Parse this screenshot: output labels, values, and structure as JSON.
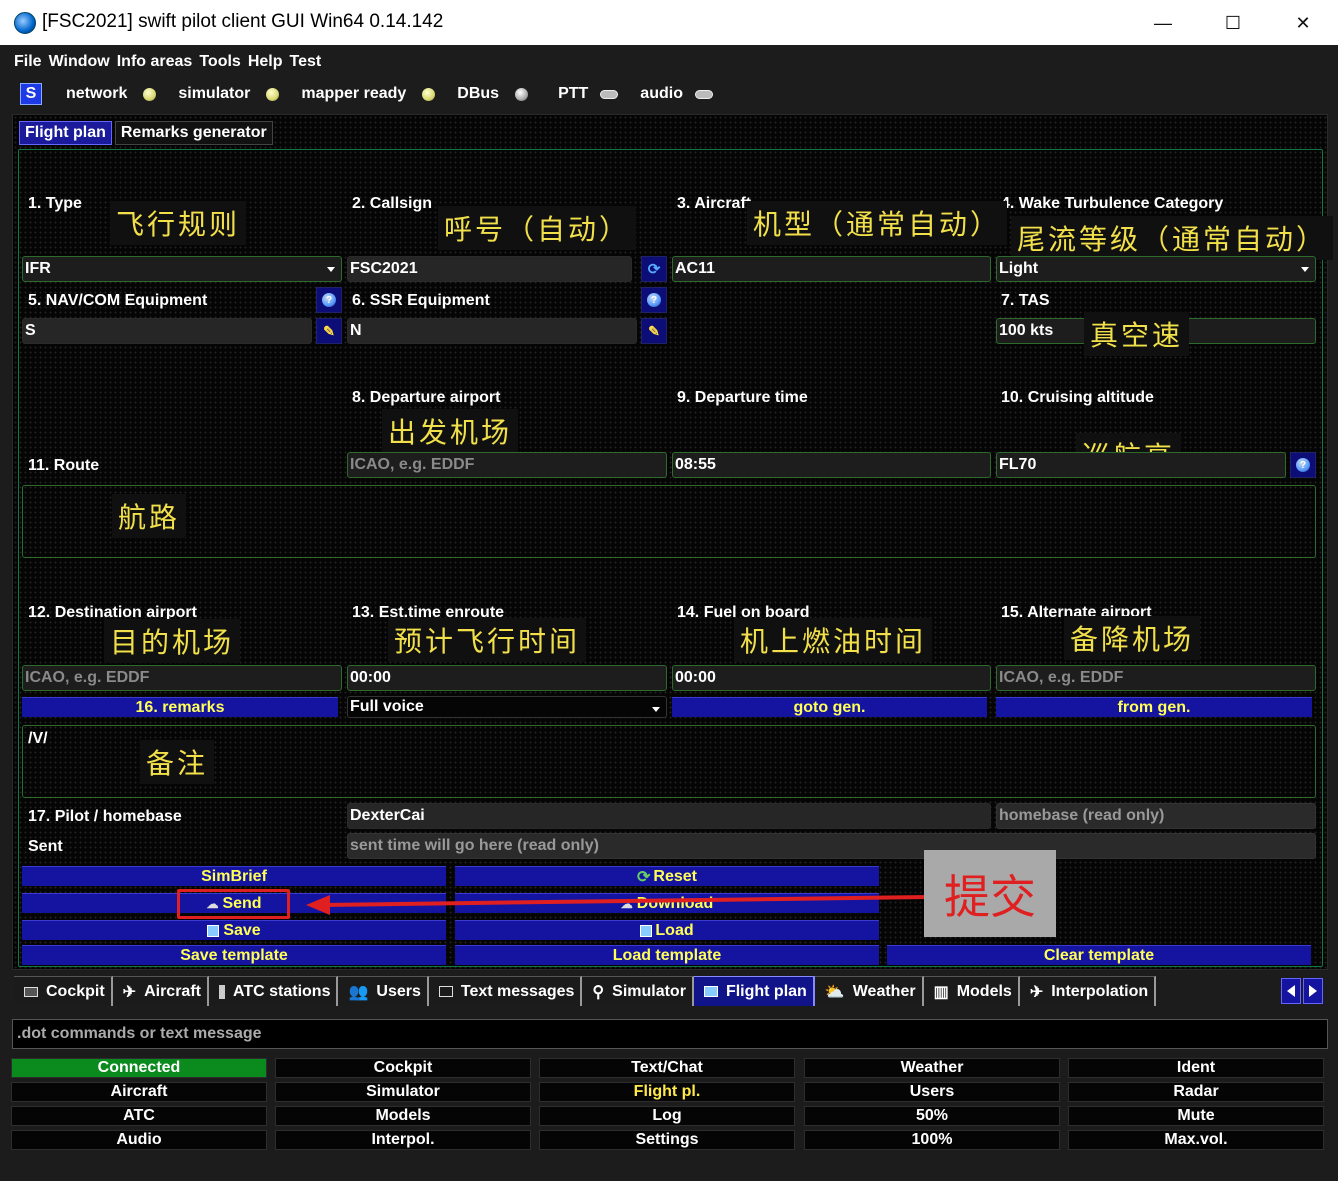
{
  "window": {
    "title": "[FSC2021] swift pilot client GUI Win64 0.14.142",
    "minimize": "—",
    "maximize": "☐",
    "close": "✕"
  },
  "menu": [
    "File",
    "Window",
    "Info areas",
    "Tools",
    "Help",
    "Test"
  ],
  "status": {
    "badge": "S",
    "items": [
      "network",
      "simulator",
      "mapper ready",
      "DBus",
      "PTT",
      "audio"
    ]
  },
  "tabs": {
    "flight_plan": "Flight plan",
    "remarks_generator": "Remarks generator"
  },
  "form": {
    "type": {
      "label": "1. Type",
      "value": "IFR",
      "note": "飞行规则"
    },
    "callsign": {
      "label": "2. Callsign",
      "value": "FSC2021",
      "note": "呼号（自动）"
    },
    "aircraft": {
      "label": "3. Aircraft",
      "value": "AC11",
      "note": "机型（通常自动）"
    },
    "wake": {
      "label": "4. Wake Turbulence Category",
      "value": "Light",
      "note": "尾流等级（通常自动）"
    },
    "navcom": {
      "label": "5. NAV/COM Equipment",
      "value": "S"
    },
    "ssr": {
      "label": "6. SSR Equipment",
      "value": "N"
    },
    "tas": {
      "label": "7. TAS",
      "value": "100 kts",
      "note": "真空速"
    },
    "departure": {
      "label": "8. Departure airport",
      "placeholder": "ICAO, e.g. EDDF",
      "note": "出发机场"
    },
    "dep_time": {
      "label": "9. Departure time",
      "value": "08:55"
    },
    "cruise": {
      "label": "10. Cruising altitude",
      "value": "FL70",
      "note": "巡航高"
    },
    "route": {
      "label": "11. Route",
      "note": "航路"
    },
    "destination": {
      "label": "12. Destination airport",
      "placeholder": "ICAO, e.g. EDDF",
      "note": "目的机场"
    },
    "enroute": {
      "label": "13. Est.time enroute",
      "value": "00:00",
      "note": "预计飞行时间"
    },
    "fuel": {
      "label": "14. Fuel on board",
      "value": "00:00",
      "note": "机上燃油时间"
    },
    "alternate": {
      "label": "15. Alternate airport",
      "placeholder": "ICAO, e.g. EDDF",
      "note": "备降机场"
    },
    "remarks_btn": "16. remarks",
    "voice": "Full voice",
    "goto_gen": "goto gen.",
    "from_gen": "from gen.",
    "remarks": {
      "value": "/V/",
      "note": "备注"
    },
    "pilot": {
      "label": "17. Pilot / homebase",
      "value": "DexterCai",
      "homebase_placeholder": "homebase (read only)"
    },
    "sent": {
      "label": "Sent",
      "placeholder": "sent time will go here (read only)"
    }
  },
  "actions": {
    "simbrief": "SimBrief",
    "reset": "Reset",
    "send": "Send",
    "download": "Download",
    "save": "Save",
    "load": "Load",
    "save_template": "Save template",
    "load_template": "Load template",
    "clear_template": "Clear template"
  },
  "annotation": {
    "submit": "提交"
  },
  "bottom_tabs": [
    "Cockpit",
    "Aircraft",
    "ATC stations",
    "Users",
    "Text messages",
    "Simulator",
    "Flight plan",
    "Weather",
    "Models",
    "Interpolation"
  ],
  "command_placeholder": ".dot commands or text message",
  "grid": [
    [
      "Connected",
      "Cockpit",
      "Text/Chat",
      "Weather",
      "Ident"
    ],
    [
      "Aircraft",
      "Simulator",
      "Flight pl.",
      "Users",
      "Radar"
    ],
    [
      "ATC",
      "Models",
      "Log",
      "50%",
      "Mute"
    ],
    [
      "Audio",
      "Interpol.",
      "Settings",
      "100%",
      "Max.vol."
    ]
  ],
  "colors": {
    "accent": "#1414a0",
    "button_text": "#ffff55",
    "connected": "#0b8a1d",
    "annotation": "#f2e04a",
    "highlight": "#e02020"
  }
}
